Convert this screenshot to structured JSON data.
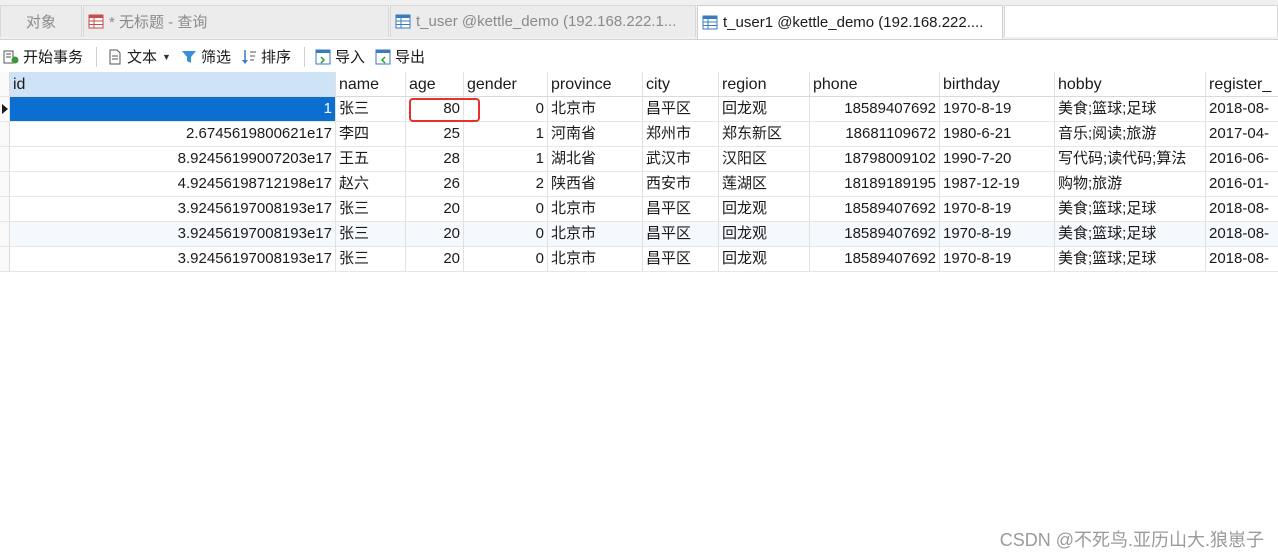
{
  "tabs": [
    {
      "label": "对象",
      "icon": "",
      "active": false
    },
    {
      "label": "* 无标题 - 查询",
      "icon": "query-icon",
      "active": false
    },
    {
      "label": "t_user @kettle_demo (192.168.222.1...",
      "icon": "table-icon",
      "active": false
    },
    {
      "label": "t_user1 @kettle_demo (192.168.222....",
      "icon": "table-icon",
      "active": true
    }
  ],
  "toolbar": {
    "begin_transaction": "开始事务",
    "text": "文本",
    "filter": "筛选",
    "sort": "排序",
    "import": "导入",
    "export": "导出"
  },
  "grid": {
    "columns": [
      "id",
      "name",
      "age",
      "gender",
      "province",
      "city",
      "region",
      "phone",
      "birthday",
      "hobby",
      "register_"
    ],
    "rows": [
      [
        "1",
        "张三",
        "80",
        "0",
        "北京市",
        "昌平区",
        "回龙观",
        "18589407692",
        "1970-8-19",
        "美食;篮球;足球",
        "2018-08-"
      ],
      [
        "2.6745619800621e17",
        "李四",
        "25",
        "1",
        "河南省",
        "郑州市",
        "郑东新区",
        "18681109672",
        "1980-6-21",
        "音乐;阅读;旅游",
        "2017-04-"
      ],
      [
        "8.92456199007203e17",
        "王五",
        "28",
        "1",
        "湖北省",
        "武汉市",
        "汉阳区",
        "18798009102",
        "1990-7-20",
        "写代码;读代码;算法",
        "2016-06-"
      ],
      [
        "4.92456198712198e17",
        "赵六",
        "26",
        "2",
        "陕西省",
        "西安市",
        "莲湖区",
        "18189189195",
        "1987-12-19",
        "购物;旅游",
        "2016-01-"
      ],
      [
        "3.92456197008193e17",
        "张三",
        "20",
        "0",
        "北京市",
        "昌平区",
        "回龙观",
        "18589407692",
        "1970-8-19",
        "美食;篮球;足球",
        "2018-08-"
      ],
      [
        "3.92456197008193e17",
        "张三",
        "20",
        "0",
        "北京市",
        "昌平区",
        "回龙观",
        "18589407692",
        "1970-8-19",
        "美食;篮球;足球",
        "2018-08-"
      ],
      [
        "3.92456197008193e17",
        "张三",
        "20",
        "0",
        "北京市",
        "昌平区",
        "回龙观",
        "18589407692",
        "1970-8-19",
        "美食;篮球;足球",
        "2018-08-"
      ]
    ]
  },
  "watermark": "CSDN @不死鸟.亚历山大.狼崽子",
  "colors": {
    "selection": "#0a6fd0",
    "highlight": "#e8312a"
  }
}
